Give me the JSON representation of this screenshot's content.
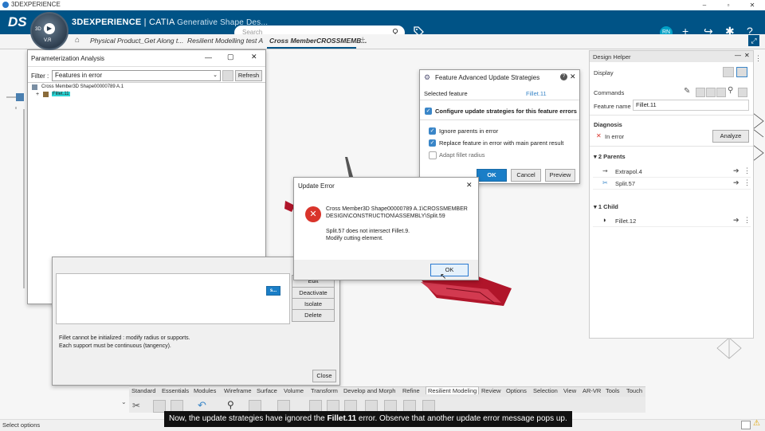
{
  "window": {
    "title": "3DEXPERIENCE",
    "min": "–",
    "max": "▫",
    "close": "✕"
  },
  "topbar": {
    "logo": "DS",
    "brand_strong": "3DEXPERIENCE",
    "brand_sep": " | CATIA ",
    "brand_app": "Generative Shape Des...",
    "compass_3d": "3D",
    "compass_version": "V.R",
    "search_placeholder": "Search",
    "search_icon": "⚲",
    "avatar": "RN"
  },
  "tabs": [
    {
      "label": "Physical Product_Get Along t..."
    },
    {
      "label": "Resilient Modelling test A"
    },
    {
      "label": "Cross MemberCROSSMEMB..."
    }
  ],
  "param_analysis": {
    "title": "Parameterization Analysis",
    "filter_label": "Filter :",
    "filter_value": "Features in error",
    "refresh": "Refresh",
    "tree_root": "Cross Member3D Shape00000789 A.1",
    "tree_child": "Fillet.11"
  },
  "advanced": {
    "title": "Feature Advanced Update Strategies",
    "help": "?",
    "selected_label": "Selected feature",
    "selected_value": "Fillet.11",
    "configure": "Configure update strategies for this feature errors",
    "opt1": "Ignore parents in error",
    "opt2": "Replace feature in error with main parent result",
    "opt3": "Adapt fillet radius",
    "ok": "OK",
    "cancel": "Cancel",
    "preview": "Preview"
  },
  "update_error": {
    "title": "Update Error",
    "path_line1": "Cross Member3D Shape00000789 A.1\\CROSSMEMBER",
    "path_line2": "DESIGN\\CONSTRUCTION\\ASSEMBLY\\Split.59",
    "msg1": "Split.57 does not intersect Fillet.9.",
    "msg2": "Modify cutting element.",
    "ok": "OK"
  },
  "back_dialog": {
    "edit": "Edit",
    "deactivate": "Deactivate",
    "isolate": "Isolate",
    "delete": "Delete",
    "msg1": "Fillet cannot be initialized : modify radius or supports.",
    "msg2": "Each support must be continuous (tangency).",
    "close": "Close",
    "partial_btn": "s..."
  },
  "design_helper": {
    "title": "Design Helper",
    "display": "Display",
    "commands": "Commands",
    "feature_name_label": "Feature name",
    "feature_name_value": "Fillet.11",
    "diagnosis": "Diagnosis",
    "in_error": "In error",
    "analyze": "Analyze",
    "parents_header": "2 Parents",
    "parents": [
      "Extrapol.4",
      "Split.57"
    ],
    "child_header": "1 Child",
    "children": [
      "Fillet.12"
    ]
  },
  "bottom_tabs": [
    "Standard",
    "Essentials",
    "Modules",
    "Wireframe",
    "Surface",
    "Volume",
    "Transform",
    "Develop and Morph",
    "Refine",
    "Resilient Modeling",
    "Review",
    "Options",
    "Selection",
    "View",
    "AR-VR",
    "Tools",
    "Touch"
  ],
  "caption": {
    "before": "Now, the update strategies have ignored the ",
    "bold": "Fillet.11",
    "after": " error. Observe that another update error message pops up."
  },
  "status": "Select options",
  "colors": {
    "brand_blue": "#005386",
    "accent": "#1a7ec7",
    "error_red": "#d9342b",
    "part_red": "#b0152a"
  }
}
